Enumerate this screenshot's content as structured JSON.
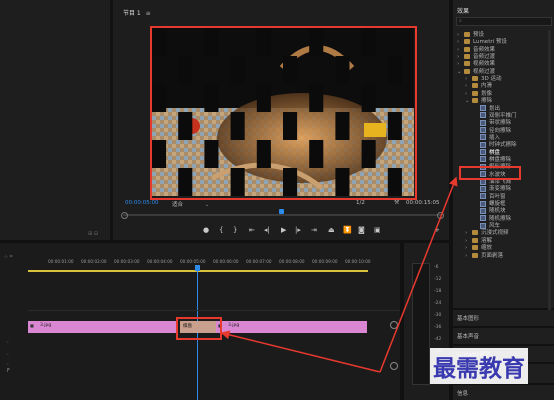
{
  "program_monitor": {
    "tab_title": "节目 1",
    "timecode_left": "00:00:05:00",
    "fit_label": "适合",
    "fraction": "1/2",
    "timecode_right": "00:00:15:05"
  },
  "timeline": {
    "ruler_labels": [
      "00:00:01:00",
      "00:00:02:00",
      "00:00:03:00",
      "00:00:04:00",
      "00:00:05:00",
      "00:00:06:00",
      "00:00:07:00",
      "00:00:08:00",
      "00:00:09:00",
      "00:00:10:00"
    ],
    "clip_left_name": "3.jpg",
    "clip_right_name": "3.jpg",
    "transition_name": "棋盘",
    "bottom_left_label": "F"
  },
  "effects_panel": {
    "title": "效果",
    "tree": [
      {
        "label": "预设",
        "level": 0,
        "expanded": false,
        "type": "folder"
      },
      {
        "label": "Lumetri 预设",
        "level": 0,
        "expanded": false,
        "type": "folder"
      },
      {
        "label": "音频效果",
        "level": 0,
        "expanded": false,
        "type": "folder"
      },
      {
        "label": "音频过渡",
        "level": 0,
        "expanded": false,
        "type": "folder"
      },
      {
        "label": "视频效果",
        "level": 0,
        "expanded": false,
        "type": "folder"
      },
      {
        "label": "视频过渡",
        "level": 0,
        "expanded": true,
        "type": "folder"
      },
      {
        "label": "3D 运动",
        "level": 1,
        "expanded": false,
        "type": "folder"
      },
      {
        "label": "内滑",
        "level": 1,
        "expanded": false,
        "type": "folder"
      },
      {
        "label": "划像",
        "level": 1,
        "expanded": false,
        "type": "folder"
      },
      {
        "label": "擦除",
        "level": 1,
        "expanded": true,
        "type": "folder"
      },
      {
        "label": "划出",
        "level": 2,
        "type": "fx"
      },
      {
        "label": "双侧平推门",
        "level": 2,
        "type": "fx"
      },
      {
        "label": "带状擦除",
        "level": 2,
        "type": "fx"
      },
      {
        "label": "径向擦除",
        "level": 2,
        "type": "fx"
      },
      {
        "label": "插入",
        "level": 2,
        "type": "fx"
      },
      {
        "label": "时钟式擦除",
        "level": 2,
        "type": "fx"
      },
      {
        "label": "棋盘",
        "level": 2,
        "type": "fx",
        "highlight": true
      },
      {
        "label": "棋盘擦除",
        "level": 2,
        "type": "fx"
      },
      {
        "label": "楔形擦除",
        "level": 2,
        "type": "fx"
      },
      {
        "label": "水波块",
        "level": 2,
        "type": "fx"
      },
      {
        "label": "油漆飞溅",
        "level": 2,
        "type": "fx"
      },
      {
        "label": "渐变擦除",
        "level": 2,
        "type": "fx"
      },
      {
        "label": "百叶窗",
        "level": 2,
        "type": "fx"
      },
      {
        "label": "螺旋框",
        "level": 2,
        "type": "fx"
      },
      {
        "label": "随机块",
        "level": 2,
        "type": "fx"
      },
      {
        "label": "随机擦除",
        "level": 2,
        "type": "fx"
      },
      {
        "label": "风车",
        "level": 2,
        "type": "fx"
      },
      {
        "label": "沉浸式视频",
        "level": 1,
        "expanded": false,
        "type": "folder"
      },
      {
        "label": "溶解",
        "level": 1,
        "expanded": false,
        "type": "folder"
      },
      {
        "label": "缩放",
        "level": 1,
        "expanded": false,
        "type": "folder"
      },
      {
        "label": "页面剥落",
        "level": 1,
        "expanded": false,
        "type": "folder"
      }
    ],
    "sections": [
      "基本图形",
      "基本声音",
      "Lumetri 颜色",
      "库"
    ],
    "lower_tab": "信息"
  },
  "audio_meter_labels": [
    "-6",
    "-12",
    "-18",
    "-24",
    "-30",
    "-36",
    "-42",
    "-48",
    "-54"
  ],
  "watermark": "最需教育",
  "colors": {
    "accent_blue": "#2d8ceb",
    "highlight_red": "#e8392f",
    "clip_pink": "#d987d2",
    "timeline_yellow": "#d9c23a"
  }
}
